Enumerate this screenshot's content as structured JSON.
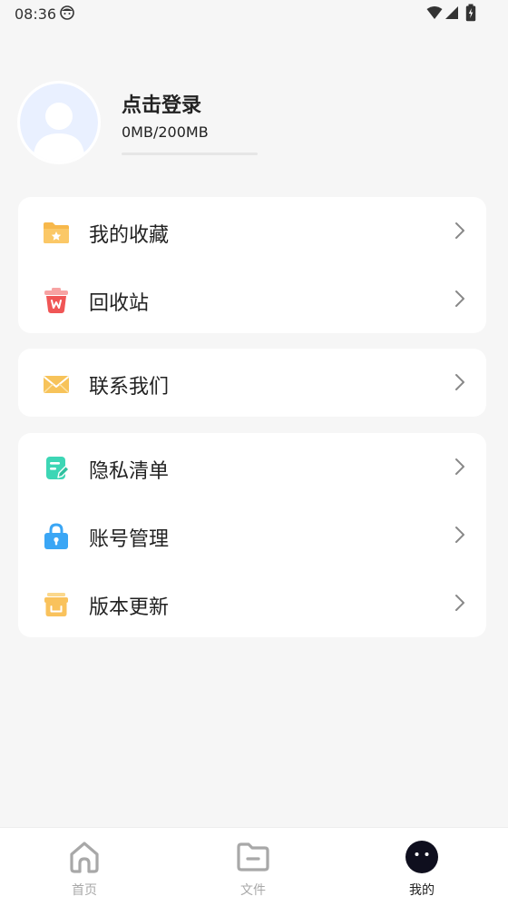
{
  "status_bar": {
    "time": "08:36"
  },
  "profile": {
    "login_label": "点击登录",
    "storage_text": "0MB/200MB",
    "storage_used_fraction": 0
  },
  "menu_groups": [
    {
      "items": [
        {
          "label": "我的收藏",
          "icon": "folder-star-icon"
        },
        {
          "label": "回收站",
          "icon": "trash-icon"
        }
      ]
    },
    {
      "items": [
        {
          "label": "联系我们",
          "icon": "mail-icon"
        }
      ]
    },
    {
      "items": [
        {
          "label": "隐私清单",
          "icon": "privacy-list-icon"
        },
        {
          "label": "账号管理",
          "icon": "lock-icon"
        },
        {
          "label": "版本更新",
          "icon": "box-icon"
        }
      ]
    }
  ],
  "bottom_nav": {
    "tabs": [
      {
        "label": "首页",
        "icon": "home-icon",
        "active": false
      },
      {
        "label": "文件",
        "icon": "folder-icon",
        "active": false
      },
      {
        "label": "我的",
        "icon": "profile-face-icon",
        "active": true
      }
    ]
  },
  "colors": {
    "background": "#f6f6f6",
    "card": "#ffffff",
    "accent_blue": "#7aa7ff",
    "folder_yellow": "#f7b84b",
    "trash_red": "#f05656",
    "mail_yellow": "#f7c35a",
    "privacy_teal": "#3dd6b5",
    "lock_blue": "#3aa6f5",
    "box_yellow": "#f9c25c"
  }
}
